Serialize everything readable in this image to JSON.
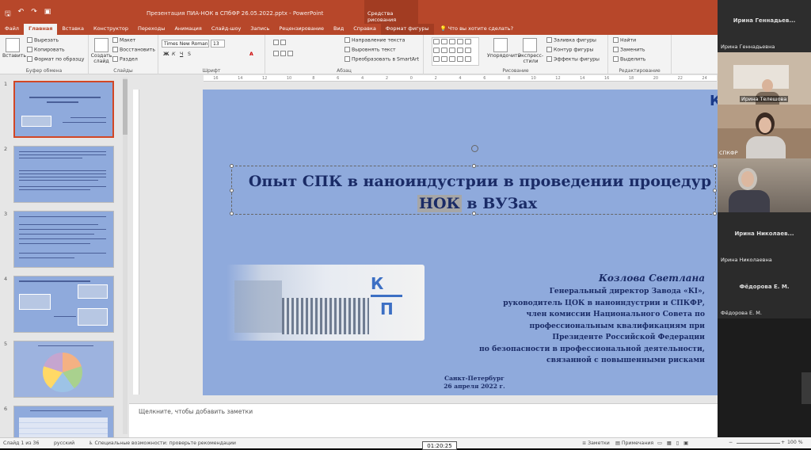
{
  "titlebar": {
    "title": "Презентация ПИА-НОК в СПбФР 26.05.2022.pptx  -  PowerPoint",
    "context_group": "Средства рисования"
  },
  "tabs": [
    "Файл",
    "Главная",
    "Вставка",
    "Конструктор",
    "Переходы",
    "Анимация",
    "Слайд-шоу",
    "Запись",
    "Рецензирование",
    "Вид",
    "Справка",
    "Формат фигуры"
  ],
  "active_tab": "Главная",
  "tell_me": "Что вы хотите сделать?",
  "ribbon": {
    "clipboard": {
      "paste": "Вставить",
      "cut": "Вырезать",
      "copy": "Копировать",
      "format_painter": "Формат по образцу",
      "label": "Буфер обмена"
    },
    "slides": {
      "new_slide": "Создать слайд",
      "layout": "Макет",
      "reset": "Восстановить",
      "section": "Раздел",
      "label": "Слайды"
    },
    "font": {
      "name": "Times New Roman",
      "size": "13",
      "label": "Шрифт",
      "bold": "Ж",
      "italic": "К",
      "underline": "Ч",
      "strike": "S",
      "font_color": "A"
    },
    "paragraph": {
      "text_dir": "Направление текста",
      "align_text": "Выровнять текст",
      "smartart": "Преобразовать в SmartArt",
      "label": "Абзац"
    },
    "drawing": {
      "arrange": "Упорядочить",
      "quick_styles": "Экспресс-стили",
      "fill": "Заливка фигуры",
      "outline": "Контур фигуры",
      "effects": "Эффекты фигуры",
      "label": "Рисование"
    },
    "editing": {
      "find": "Найти",
      "replace": "Заменить",
      "select": "Выделить",
      "label": "Редактирование"
    }
  },
  "ruler": [
    "16",
    "14",
    "12",
    "10",
    "8",
    "6",
    "4",
    "2",
    "0",
    "2",
    "4",
    "6",
    "8",
    "10",
    "12",
    "14",
    "16",
    "18",
    "20",
    "22",
    "24"
  ],
  "thumbs": [
    "1",
    "2",
    "3",
    "4",
    "5",
    "6"
  ],
  "slide": {
    "corner_logo": "К",
    "title_line1": "Опыт СПК в наноиндустрии в проведении процедур",
    "title_hl": "НОК",
    "title_line2_rest": " в ВУЗах",
    "name": "Козлова Светлана",
    "bio": [
      "Генеральный директор Завода «KI»,",
      "руководитель ЦОК в наноиндустрии и СПКФР,",
      "член комиссии Национального Совета  по",
      "профессиональным квалификациям при",
      "Президенте Российской Федерации",
      "по безопасности в профессиональной деятельности,",
      "связанной с повышенными рисками"
    ],
    "city": "Санкт-Петербург",
    "date": "26 апреля 2022 г.",
    "logo_k": "К",
    "logo_p": "П"
  },
  "notes_placeholder": "Щелкните, чтобы добавить заметки",
  "status": {
    "slide_of": "Слайд 1 из 36",
    "lang": "русский",
    "accessibility": "Специальные возможности: проверьте рекомендации",
    "notes_btn": "Заметки",
    "comments_btn": "Примечания",
    "zoom": "100 %"
  },
  "timer": "01:20:25",
  "participants": [
    {
      "top_name": "Ирина  Геннадьев...",
      "name": "Ирина Геннадьевна"
    },
    {
      "name": "Ирина Телешова"
    },
    {
      "name": "СПКФР"
    },
    {
      "name": ""
    },
    {
      "top_name": "Ирина  Николаев...",
      "name": "Ирина Николаевна"
    },
    {
      "top_name": "Фёдорова Е. М.",
      "name": "Фёдорова Е. М."
    }
  ]
}
